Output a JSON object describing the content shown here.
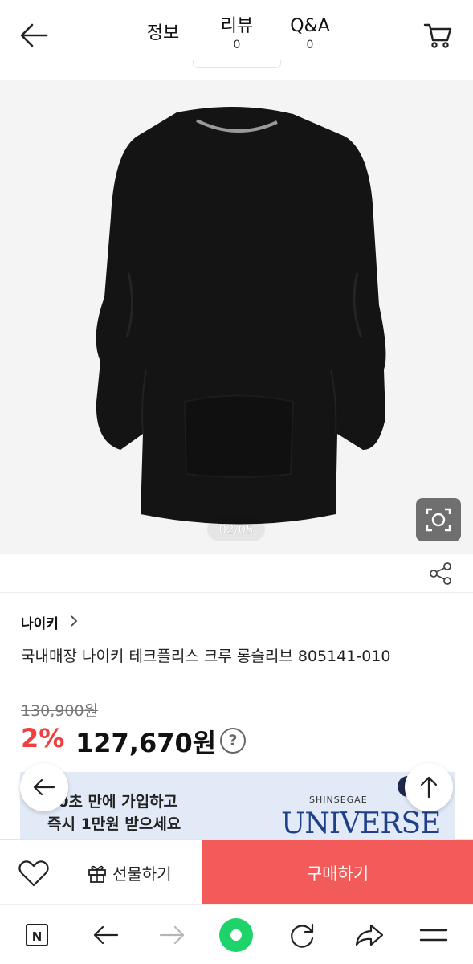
{
  "header": {
    "tabs": [
      {
        "label": "정보",
        "count": ""
      },
      {
        "label": "리뷰",
        "count": "0"
      },
      {
        "label": "Q&A",
        "count": "0"
      }
    ],
    "icons": {
      "back": "arrow-left-icon",
      "cart": "cart-icon"
    }
  },
  "gallery": {
    "page_indicator": "02/05",
    "lens_icon": "image-search-icon"
  },
  "product": {
    "brand": "나이키",
    "title": "국내매장 나이키 테크플리스 크루 롱슬리브 805141-010",
    "original_price": "130,900원",
    "discount": "2%",
    "price": "127,670원",
    "help": "?"
  },
  "banner": {
    "line1": "10초 만에 가입하고",
    "line2": "즉시 1만원 받으세요",
    "brand_small": "SHINSEGAE",
    "brand_big": "UNIVERSE"
  },
  "purchase_bar": {
    "gift_label": "선물하기",
    "buy_label": "구매하기",
    "buy_color": "#f35a5a"
  },
  "browser_nav": {
    "home_label": "N",
    "icons": [
      "naver-home-icon",
      "back-arrow-icon",
      "forward-arrow-icon",
      "green-dot-icon",
      "reload-icon",
      "share-icon",
      "menu-icon"
    ],
    "accent": "#1fd36b"
  }
}
